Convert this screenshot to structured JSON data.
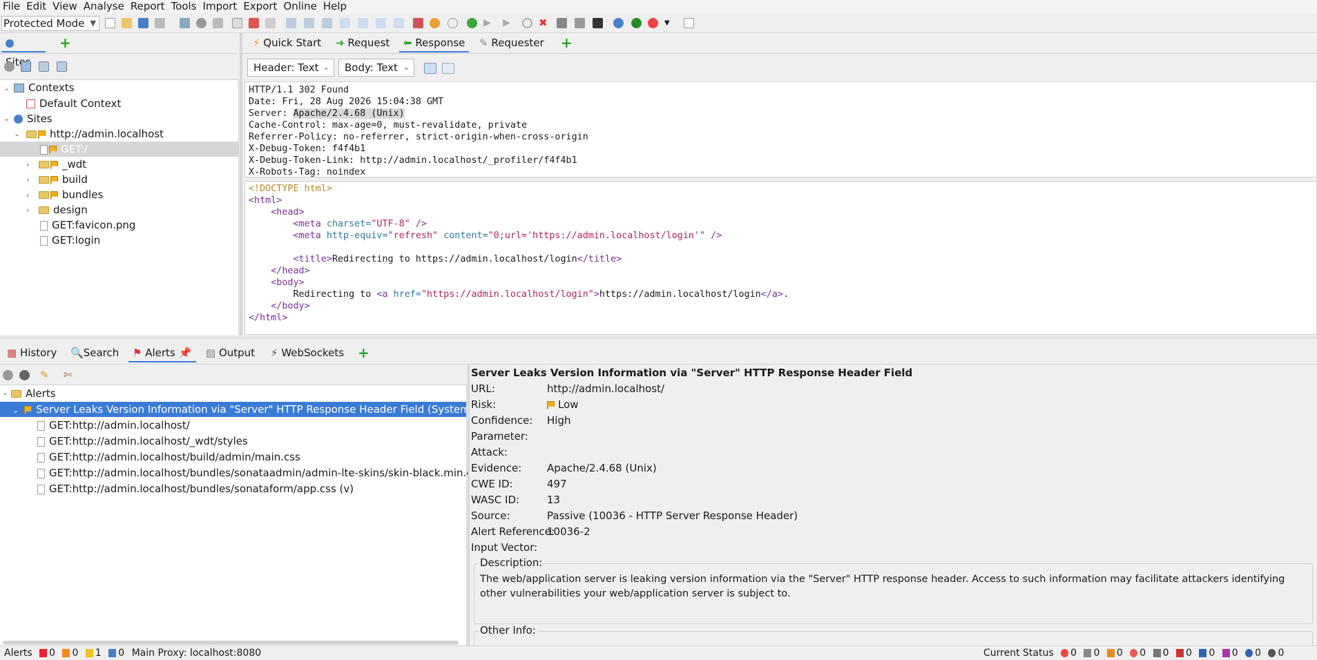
{
  "menu": [
    "File",
    "Edit",
    "View",
    "Analyse",
    "Report",
    "Tools",
    "Import",
    "Export",
    "Online",
    "Help"
  ],
  "toolbar": {
    "mode": "Protected Mode"
  },
  "sites_panel": {
    "tab_label": "Sites",
    "tree": {
      "contexts": "Contexts",
      "default_context": "Default Context",
      "sites": "Sites",
      "host": "http://admin.localhost",
      "children": [
        "GET:/",
        "_wdt",
        "build",
        "bundles",
        "design",
        "GET:favicon.png",
        "GET:login"
      ]
    }
  },
  "rr_tabs": {
    "quick_start": "Quick Start",
    "request": "Request",
    "response": "Response",
    "requester": "Requester"
  },
  "view_options": {
    "header": "Header: Text",
    "body": "Body: Text"
  },
  "response_header": {
    "status_line": "HTTP/1.1 302 Found",
    "date": "Date: Fri, 28 Aug 2026 15:04:38 GMT",
    "server_prefix": "Server: ",
    "server_value": "Apache/2.4.68 (Unix)",
    "cache": "Cache-Control: max-age=0, must-revalidate, private",
    "referrer": "Referrer-Policy: no-referrer, strict-origin-when-cross-origin",
    "debug_token": "X-Debug-Token: f4f4b1",
    "debug_link": "X-Debug-Token-Link: http://admin.localhost/_profiler/f4f4b1",
    "robots": "X-Robots-Tag: noindex"
  },
  "response_body": {
    "doctype": "<!DOCTYPE html>",
    "html_open": "<html>",
    "head_open": "<head>",
    "meta_charset_tag": "<meta",
    "meta_charset_attr": "charset=",
    "meta_charset_val": "\"UTF-8\"",
    "close_slash": "/>",
    "meta_refresh_attr1": "http-equiv=",
    "meta_refresh_val1": "\"refresh\"",
    "meta_refresh_attr2": "content=",
    "meta_refresh_val2": "\"0;url='https://admin.localhost/login'\"",
    "title_open": "<title>",
    "title_text": "Redirecting to https://admin.localhost/login",
    "title_close": "</title>",
    "head_close": "</head>",
    "body_open": "<body>",
    "redirect_text": "Redirecting to ",
    "a_open": "<a",
    "href_attr": "href=",
    "href_val": "\"https://admin.localhost/login\"",
    "gt": ">",
    "link_text": "https://admin.localhost/login",
    "a_close": "</a>",
    "period": ".",
    "body_close": "</body>",
    "html_close": "</html>"
  },
  "bottom_tabs": {
    "history": "History",
    "search": "Search",
    "alerts": "Alerts",
    "output": "Output",
    "websockets": "WebSockets"
  },
  "alerts_tree": {
    "root": "Alerts",
    "selected": "Server Leaks Version Information via \"Server\" HTTP Response Header Field (Systemic)",
    "items": [
      "GET:http://admin.localhost/",
      "GET:http://admin.localhost/_wdt/styles",
      "GET:http://admin.localhost/build/admin/main.css",
      "GET:http://admin.localhost/bundles/sonataadmin/admin-lte-skins/skin-black.min.css (v)",
      "GET:http://admin.localhost/bundles/sonataform/app.css (v)"
    ]
  },
  "alert_detail": {
    "title": "Server Leaks Version Information via \"Server\" HTTP Response Header Field",
    "rows": [
      {
        "k": "URL:",
        "v": "http://admin.localhost/"
      },
      {
        "k": "Risk:",
        "v": "Low"
      },
      {
        "k": "Confidence:",
        "v": "High"
      },
      {
        "k": "Parameter:",
        "v": ""
      },
      {
        "k": "Attack:",
        "v": ""
      },
      {
        "k": "Evidence:",
        "v": "Apache/2.4.68 (Unix)"
      },
      {
        "k": "CWE ID:",
        "v": "497"
      },
      {
        "k": "WASC ID:",
        "v": "13"
      },
      {
        "k": "Source:",
        "v": "Passive (10036 - HTTP Server Response Header)"
      },
      {
        "k": "Alert Reference:",
        "v": "10036-2"
      },
      {
        "k": "Input Vector:",
        "v": ""
      }
    ],
    "description_label": "Description:",
    "description": "The web/application server is leaking version information via the \"Server\" HTTP response header. Access to such information may facilitate attackers identifying other vulnerabilities your web/application server is subject to.",
    "other_info_label": "Other Info:"
  },
  "statusbar": {
    "alerts_label": "Alerts",
    "high": "0",
    "medium": "0",
    "low": "1",
    "info": "0",
    "proxy": "Main Proxy: localhost:8080",
    "current_status": "Current Status",
    "counts": [
      "0",
      "0",
      "0",
      "0",
      "0",
      "0",
      "0",
      "0",
      "0",
      "0"
    ]
  },
  "colors": {
    "accent": "#3a7bd5",
    "flag_low": "#f2b01e",
    "green": "#2aa52a"
  }
}
